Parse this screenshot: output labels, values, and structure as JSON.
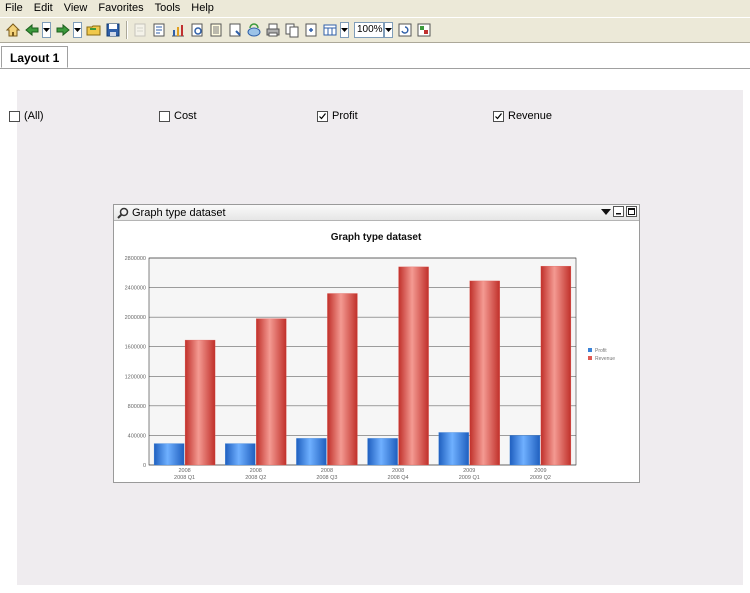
{
  "menu": [
    "File",
    "Edit",
    "View",
    "Favorites",
    "Tools",
    "Help"
  ],
  "toolbar": {
    "buttons": [
      "home-icon",
      "back-icon",
      "forward-icon",
      "open-folder-icon",
      "save-icon",
      "export-icon",
      "pdf-icon",
      "chart-type-icon",
      "print-preview-icon",
      "report-icon",
      "page-icon",
      "refresh-data-icon",
      "print-icon",
      "copy-icon",
      "page-setup-icon",
      "layout-icon",
      "refresh-icon",
      "design-icon"
    ],
    "zoom": "100%"
  },
  "tabs": [
    {
      "label": "Layout 1"
    }
  ],
  "filters": [
    {
      "label": "(All)",
      "checked": false
    },
    {
      "label": "Cost",
      "checked": false
    },
    {
      "label": "Profit",
      "checked": true
    },
    {
      "label": "Revenue",
      "checked": true
    }
  ],
  "panel": {
    "title": "Graph type dataset"
  },
  "chart_data": {
    "type": "bar",
    "title": "Graph type dataset",
    "categories": [
      [
        "2008",
        "2008 Q1"
      ],
      [
        "2008",
        "2008 Q2"
      ],
      [
        "2008",
        "2008 Q3"
      ],
      [
        "2008",
        "2008 Q4"
      ],
      [
        "2009",
        "2009 Q1"
      ],
      [
        "2009",
        "2009 Q2"
      ]
    ],
    "series": [
      {
        "name": "Profit",
        "color": "#3b82d6",
        "values": [
          290000,
          290000,
          360000,
          360000,
          440000,
          400000
        ]
      },
      {
        "name": "Revenue",
        "color": "#e05a53",
        "values": [
          1690000,
          1980000,
          2320000,
          2680000,
          2490000,
          2690000
        ]
      }
    ],
    "ylim": [
      0,
      2800000
    ],
    "yticks": [
      "0",
      "400000",
      "800000",
      "1200000",
      "1600000",
      "2000000",
      "2400000",
      "2800000"
    ],
    "grid": true,
    "legend": "right"
  }
}
